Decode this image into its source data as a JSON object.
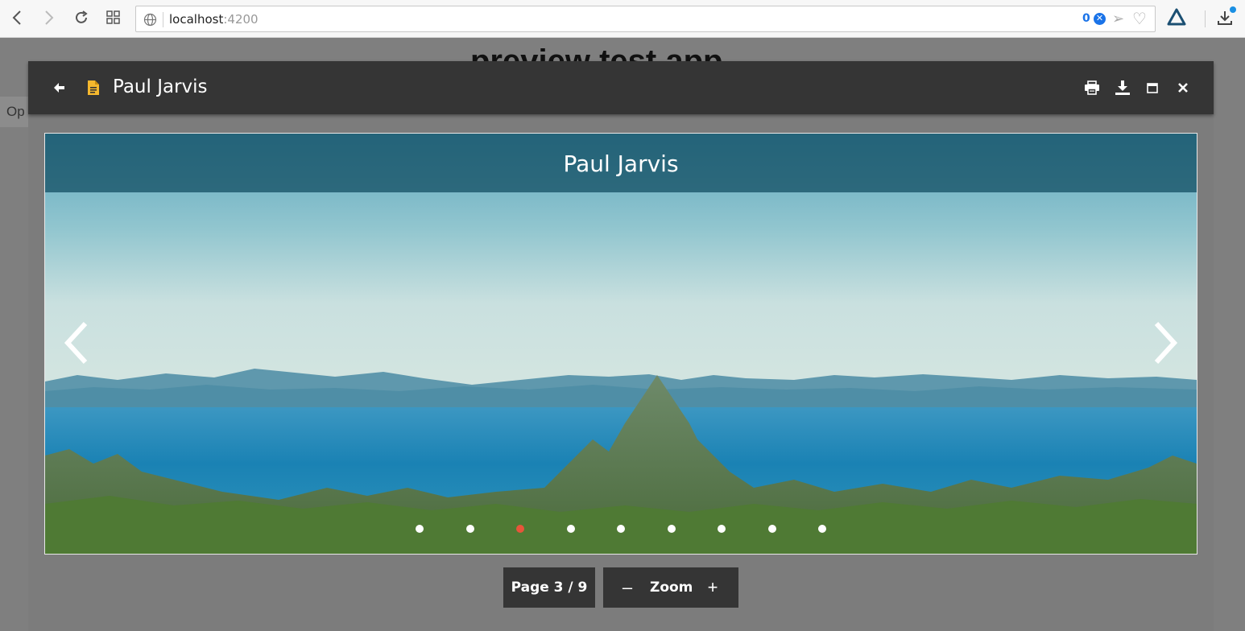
{
  "browser": {
    "url_host": "localhost",
    "url_port": ":4200",
    "blocked_count": "0"
  },
  "background_page": {
    "title": "preview test app",
    "tab_label": "Op"
  },
  "viewer": {
    "file_name": "Paul Jarvis",
    "slide_caption": "Paul Jarvis",
    "current_page": 3,
    "total_pages": 9,
    "page_label": "Page 3 / 9",
    "zoom_label": "Zoom",
    "zoom_minus": "–",
    "zoom_plus": "+",
    "active_dot_color": "#e8553a",
    "header_color": "#353535"
  },
  "icons": {
    "back": "arrow-left-icon",
    "file": "document-icon",
    "print": "print-icon",
    "download": "download-icon",
    "maximize": "maximize-icon",
    "close": "close-icon",
    "prev": "chevron-left-icon",
    "next": "chevron-right-icon"
  }
}
